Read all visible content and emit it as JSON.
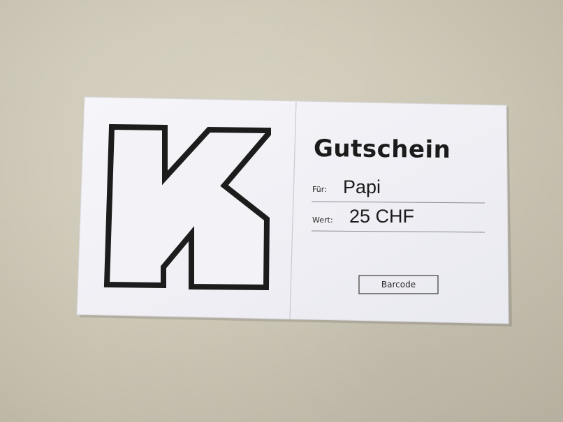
{
  "voucher": {
    "title": "Gutschein",
    "recipient_label": "Für:",
    "recipient_value": "Papi",
    "value_label": "Wert:",
    "value_amount": "25 CHF",
    "barcode_label": "Barcode",
    "logo_letter": "K",
    "colors": {
      "paper": "#f3f3f8",
      "ink": "#1c1c1c",
      "background": "#cfc9b8"
    }
  }
}
